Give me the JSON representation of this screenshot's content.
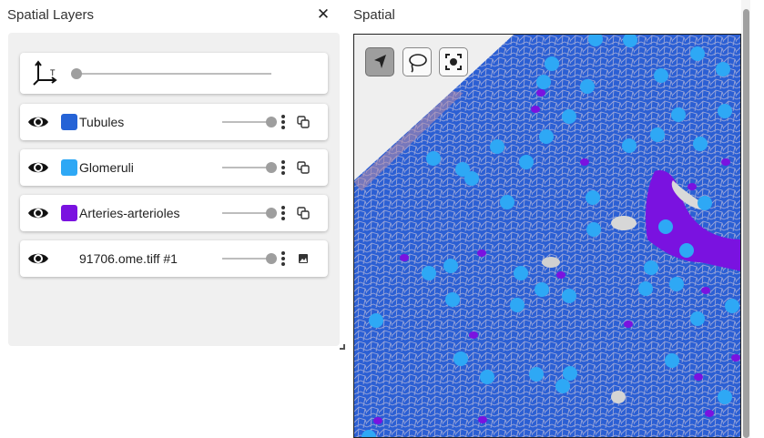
{
  "left_panel": {
    "title": "Spatial Layers",
    "close_label": "✕"
  },
  "axes_control": {
    "icon": "axes-3d-icon",
    "slider_value": 0
  },
  "layers": [
    {
      "name": "Tubules",
      "color": "#2563d6",
      "visible": true,
      "opacity": 1.0,
      "kind_icon": "layers-icon"
    },
    {
      "name": "Glomeruli",
      "color": "#2ea8f5",
      "visible": true,
      "opacity": 1.0,
      "kind_icon": "layers-icon"
    },
    {
      "name": "Arteries-arterioles",
      "color": "#7a12e0",
      "visible": true,
      "opacity": 1.0,
      "kind_icon": "layers-icon"
    },
    {
      "name": "91706.ome.tiff #1",
      "color": null,
      "visible": true,
      "opacity": 1.0,
      "kind_icon": "image-icon"
    }
  ],
  "right_panel": {
    "title": "Spatial"
  },
  "viewer": {
    "tools": [
      {
        "name": "pointer-tool",
        "icon": "navigation-arrow-icon",
        "active": true
      },
      {
        "name": "lasso-tool",
        "icon": "lasso-icon",
        "active": false
      },
      {
        "name": "recenter-tool",
        "icon": "focus-center-icon",
        "active": false
      }
    ],
    "colors": {
      "tubules": "#2563d6",
      "glomeruli": "#2ea8f5",
      "arteries": "#7a12e0",
      "background": "#efefef"
    }
  }
}
